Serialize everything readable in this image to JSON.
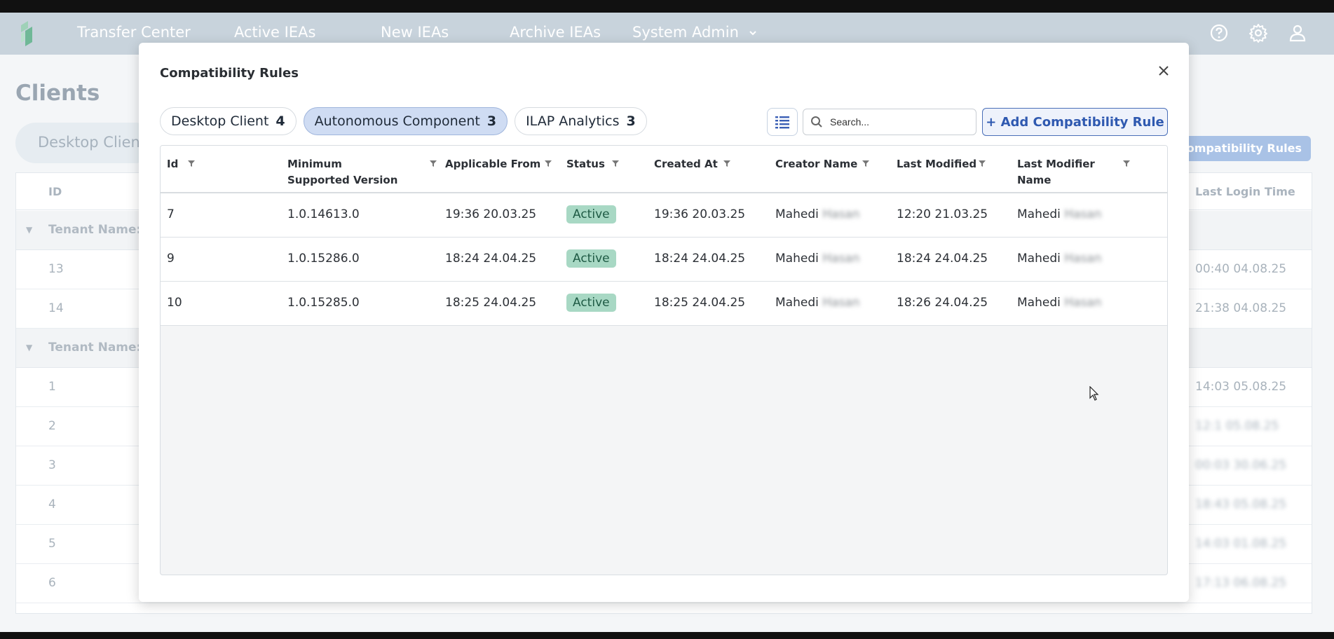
{
  "nav": {
    "items": [
      "Transfer Center",
      "Active IEAs",
      "New IEAs",
      "Archive IEAs",
      "System Admin"
    ]
  },
  "background": {
    "page_title": "Clients",
    "active_tab": "Desktop Client",
    "compat_button": "Compatibility Rules",
    "col_id": "ID",
    "col_last_login": "Last Login Time",
    "group_label": "Tenant Name: I",
    "rows": [
      {
        "id": "13",
        "time": "00:40 04.08.25"
      },
      {
        "id": "14",
        "time": "21:38 04.08.25"
      },
      {
        "id": "1",
        "time": "14:03 05.08.25"
      },
      {
        "id": "2",
        "time": "12:1 05.08.25"
      },
      {
        "id": "3",
        "time": "00:03 30.06.25"
      },
      {
        "id": "4",
        "time": "18:43 05.08.25"
      },
      {
        "id": "5",
        "time": "14:03 01.08.25"
      },
      {
        "id": "6",
        "time": "17:13 06.08.25"
      }
    ]
  },
  "modal": {
    "title": "Compatibility Rules",
    "tabs": [
      {
        "label": "Desktop Client",
        "count": "4",
        "active": false
      },
      {
        "label": "Autonomous Component",
        "count": "3",
        "active": true
      },
      {
        "label": "ILAP Analytics",
        "count": "3",
        "active": false
      }
    ],
    "search_placeholder": "Search...",
    "add_button": "+ Add Compatibility Rule",
    "columns": [
      "Id",
      "Minimum Supported Version",
      "Applicable From",
      "Status",
      "Created At",
      "Creator Name",
      "Last Modified",
      "Last Modifier Name"
    ],
    "rows": [
      {
        "id": "7",
        "version": "1.0.14613.0",
        "applicable_from": "19:36 20.03.25",
        "status": "Active",
        "created_at": "19:36 20.03.25",
        "creator_first": "Mahedi",
        "creator_last": "Hasan",
        "last_modified": "12:20 21.03.25",
        "modifier_first": "Mahedi",
        "modifier_last": "Hasan"
      },
      {
        "id": "9",
        "version": "1.0.15286.0",
        "applicable_from": "18:24 24.04.25",
        "status": "Active",
        "created_at": "18:24 24.04.25",
        "creator_first": "Mahedi",
        "creator_last": "Hasan",
        "last_modified": "18:24 24.04.25",
        "modifier_first": "Mahedi",
        "modifier_last": "Hasan"
      },
      {
        "id": "10",
        "version": "1.0.15285.0",
        "applicable_from": "18:25 24.04.25",
        "status": "Active",
        "created_at": "18:25 24.04.25",
        "creator_first": "Mahedi",
        "creator_last": "Hasan",
        "last_modified": "18:26 24.04.25",
        "modifier_first": "Mahedi",
        "modifier_last": "Hasan"
      }
    ]
  },
  "colors": {
    "nav_bg": "#c8d3dc",
    "active_tab_bg": "#cfdcf3",
    "status_active_bg": "#a8d8c4",
    "primary": "#2f59b0"
  }
}
